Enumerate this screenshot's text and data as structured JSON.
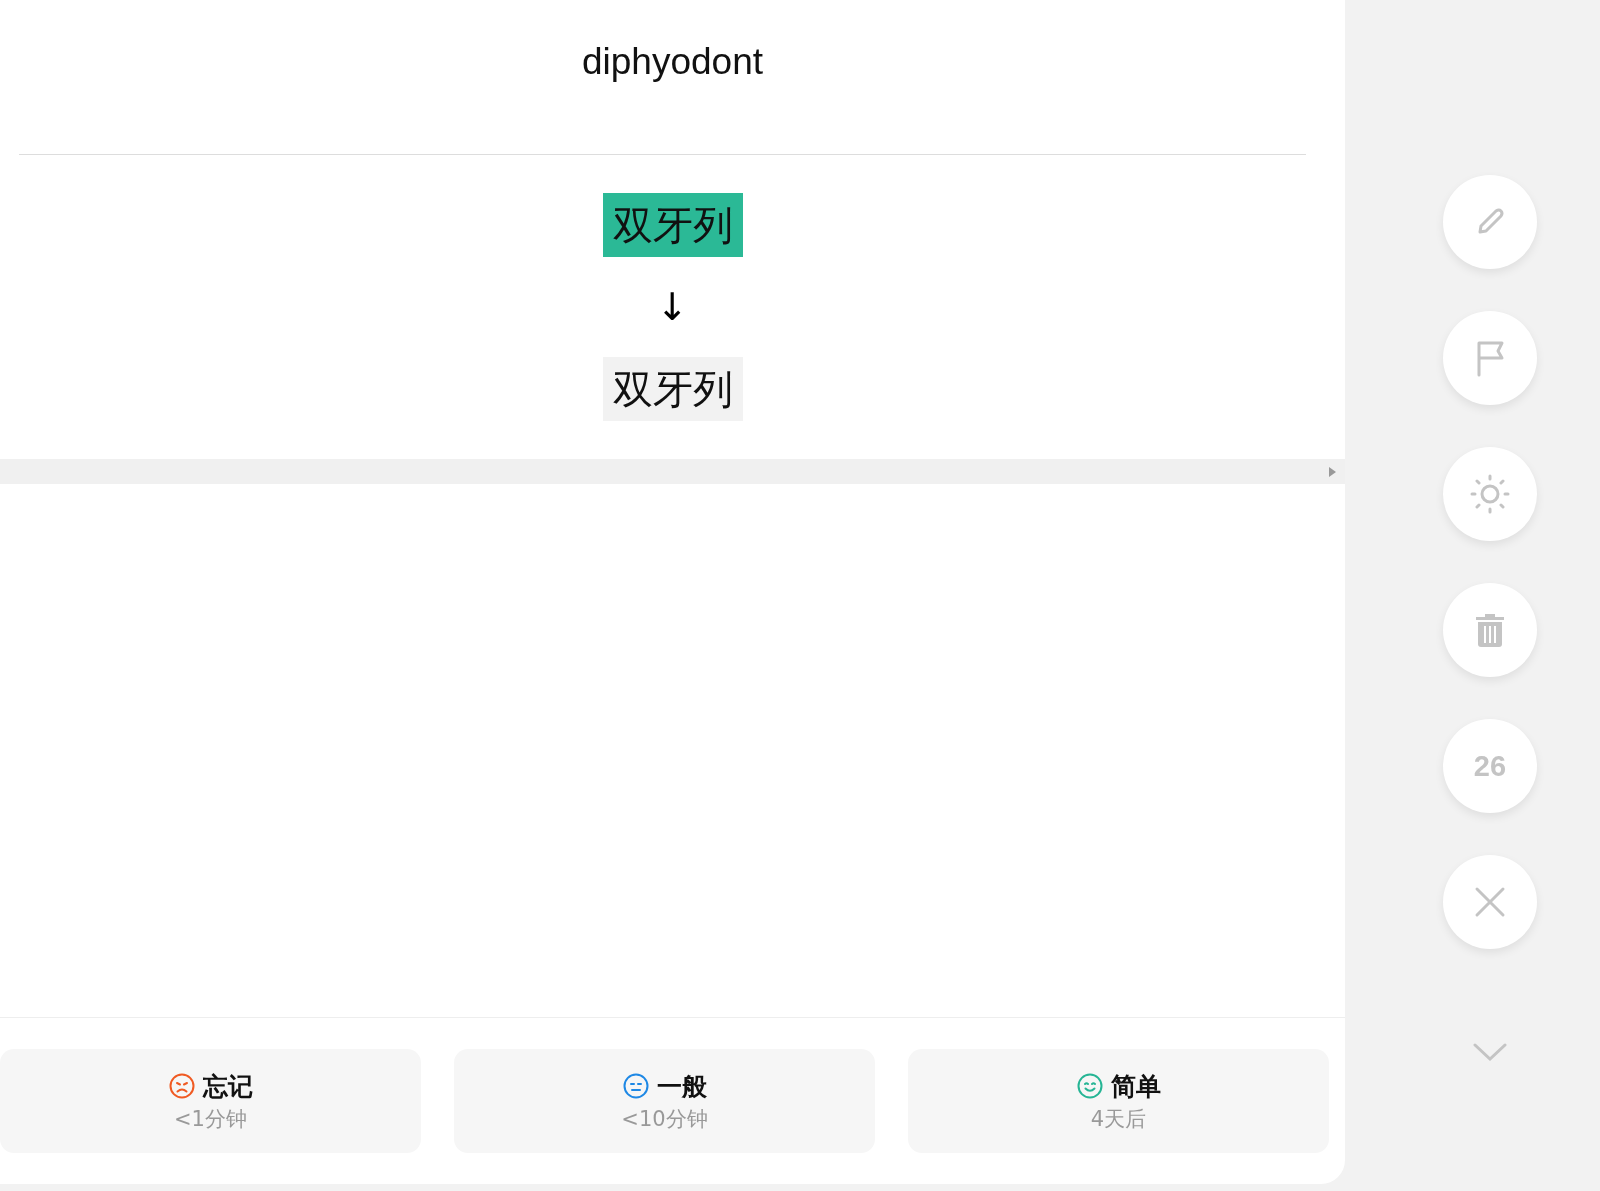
{
  "card": {
    "word": "diphyodont",
    "answer": {
      "highlighted": "双牙列",
      "arrow": "↓",
      "original": "双牙列"
    }
  },
  "ratings": [
    {
      "kind": "sad",
      "color": "#f05a22",
      "label": "忘记",
      "interval": "<1分钟"
    },
    {
      "kind": "neutral",
      "color": "#1e88e5",
      "label": "一般",
      "interval": "<10分钟"
    },
    {
      "kind": "happy",
      "color": "#26b595",
      "label": "简单",
      "interval": "4天后"
    }
  ],
  "side_actions": [
    {
      "kind": "edit"
    },
    {
      "kind": "flag"
    },
    {
      "kind": "brightness"
    },
    {
      "kind": "delete"
    },
    {
      "kind": "count",
      "text": "26"
    },
    {
      "kind": "close"
    }
  ]
}
